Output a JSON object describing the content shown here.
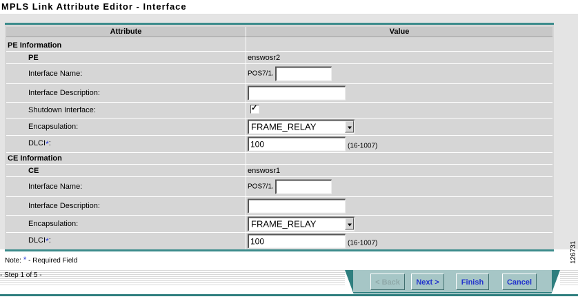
{
  "title": "MPLS Link Attribute Editor - Interface",
  "table": {
    "header": {
      "attribute": "Attribute",
      "value": "Value"
    },
    "pe_section": {
      "heading": "PE Information",
      "pe_label": "PE",
      "pe_value": "enswosr2",
      "interface_name_label": "Interface Name:",
      "interface_prefix": "POS7/1.",
      "interface_name_value": "",
      "interface_desc_label": "Interface Description:",
      "interface_desc_value": "",
      "shutdown_label": "Shutdown Interface:",
      "shutdown_checked": true,
      "encapsulation_label": "Encapsulation:",
      "encapsulation_value": "FRAME_RELAY",
      "dlci_label": "DLCI",
      "dlci_star": "*",
      "dlci_colon": ":",
      "dlci_value": "100",
      "dlci_range": "(16-1007)"
    },
    "ce_section": {
      "heading": "CE Information",
      "ce_label": "CE",
      "ce_value": "enswosr1",
      "interface_name_label": "Interface Name:",
      "interface_prefix": "POS7/1.",
      "interface_name_value": "",
      "interface_desc_label": "Interface Description:",
      "interface_desc_value": "",
      "encapsulation_label": "Encapsulation:",
      "encapsulation_value": "FRAME_RELAY",
      "dlci_label": "DLCI",
      "dlci_star": "*",
      "dlci_colon": ":",
      "dlci_value": "100",
      "dlci_range": "(16-1007)"
    }
  },
  "note": {
    "prefix": "Note: ",
    "star": "*",
    "suffix": " - Required Field"
  },
  "step": "- Step 1 of 5 -",
  "buttons": {
    "back": "< Back",
    "next": "Next >",
    "finish": "Finish",
    "cancel": "Cancel"
  },
  "figure_number": "126731",
  "colors": {
    "accent_teal": "#2f7f7f",
    "button_face": "#a6c6c6",
    "button_text": "#2233cc",
    "required_star": "#2d3fd8"
  }
}
